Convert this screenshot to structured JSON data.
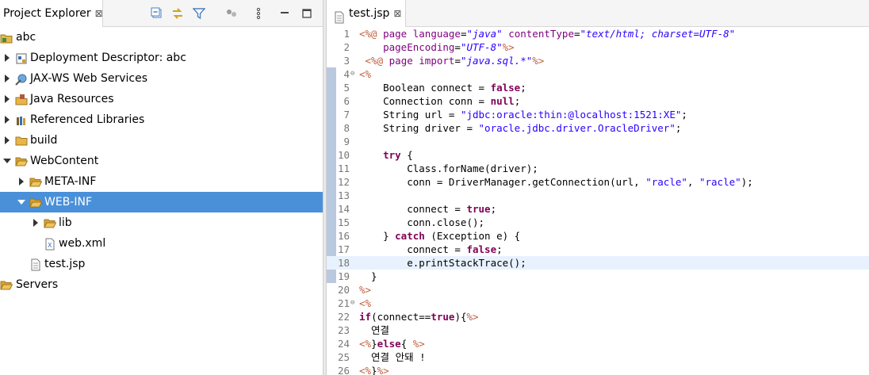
{
  "explorer": {
    "title": "Project Explorer",
    "close_glyph": "⊠",
    "toolbar_icons": [
      "collapse-all-icon",
      "link-with-editor-icon",
      "filter-icon",
      "overview-icon",
      "view-menu-icon",
      "minimize-icon",
      "maximize-icon"
    ],
    "tree": [
      {
        "label": "abc",
        "icon": "project-icon",
        "expanded": true
      },
      {
        "label": "Deployment Descriptor: abc",
        "icon": "deployment-descriptor-icon",
        "expanded": false
      },
      {
        "label": "JAX-WS Web Services",
        "icon": "web-services-icon",
        "expanded": false
      },
      {
        "label": "Java Resources",
        "icon": "java-resources-icon",
        "expanded": false
      },
      {
        "label": "Referenced Libraries",
        "icon": "libraries-icon",
        "expanded": false
      },
      {
        "label": "build",
        "icon": "folder-icon",
        "expanded": false
      },
      {
        "label": "WebContent",
        "icon": "folder-open-icon",
        "expanded": true
      },
      {
        "label": "META-INF",
        "icon": "folder-icon",
        "expanded": false
      },
      {
        "label": "WEB-INF",
        "icon": "folder-open-icon",
        "expanded": true,
        "selected": true
      },
      {
        "label": "lib",
        "icon": "folder-icon",
        "expanded": false
      },
      {
        "label": "web.xml",
        "icon": "xml-file-icon"
      },
      {
        "label": "test.jsp",
        "icon": "jsp-file-icon"
      },
      {
        "label": "Servers",
        "icon": "folder-open-icon"
      }
    ]
  },
  "editor": {
    "tab_label": "test.jsp",
    "close_glyph": "⊠",
    "current_line": 18,
    "lines": [
      {
        "n": "1",
        "fold": "",
        "tokens": [
          [
            "tag",
            "<%@ "
          ],
          [
            "attr",
            "page "
          ],
          [
            "attr",
            "language"
          ],
          [
            "plain",
            "="
          ],
          [
            "val",
            "\"java\""
          ],
          [
            "plain",
            " "
          ],
          [
            "attr",
            "contentType"
          ],
          [
            "plain",
            "="
          ],
          [
            "val",
            "\"text/html; charset=UTF-8\""
          ]
        ]
      },
      {
        "n": "2",
        "fold": "",
        "tokens": [
          [
            "plain",
            "    "
          ],
          [
            "attr",
            "pageEncoding"
          ],
          [
            "plain",
            "="
          ],
          [
            "val",
            "\"UTF-8\""
          ],
          [
            "tag",
            "%>"
          ]
        ]
      },
      {
        "n": "3",
        "fold": "",
        "tokens": [
          [
            "plain",
            " "
          ],
          [
            "tag",
            "<%@ "
          ],
          [
            "attr",
            "page "
          ],
          [
            "attr",
            "import"
          ],
          [
            "plain",
            "="
          ],
          [
            "val",
            "\"java.sql.*\""
          ],
          [
            "tag",
            "%>"
          ]
        ]
      },
      {
        "n": "4",
        "fold": "⊖",
        "tokens": [
          [
            "tag",
            "<%"
          ]
        ]
      },
      {
        "n": "5",
        "fold": "",
        "tokens": [
          [
            "plain",
            "    Boolean connect = "
          ],
          [
            "kw",
            "false"
          ],
          [
            "plain",
            ";"
          ]
        ]
      },
      {
        "n": "6",
        "fold": "",
        "tokens": [
          [
            "plain",
            "    Connection conn = "
          ],
          [
            "kw",
            "null"
          ],
          [
            "plain",
            ";"
          ]
        ]
      },
      {
        "n": "7",
        "fold": "",
        "tokens": [
          [
            "plain",
            "    String url = "
          ],
          [
            "str",
            "\"jdbc:oracle:thin:@localhost:1521:XE\""
          ],
          [
            "plain",
            ";"
          ]
        ]
      },
      {
        "n": "8",
        "fold": "",
        "tokens": [
          [
            "plain",
            "    String driver = "
          ],
          [
            "str",
            "\"oracle.jdbc.driver.OracleDriver\""
          ],
          [
            "plain",
            ";"
          ]
        ]
      },
      {
        "n": "9",
        "fold": "",
        "tokens": []
      },
      {
        "n": "10",
        "fold": "",
        "tokens": [
          [
            "plain",
            "    "
          ],
          [
            "kw",
            "try"
          ],
          [
            "plain",
            " {"
          ]
        ]
      },
      {
        "n": "11",
        "fold": "",
        "tokens": [
          [
            "plain",
            "        Class.forName(driver);"
          ]
        ]
      },
      {
        "n": "12",
        "fold": "",
        "tokens": [
          [
            "plain",
            "        conn = DriverManager.getConnection(url, "
          ],
          [
            "str",
            "\"racle\""
          ],
          [
            "plain",
            ", "
          ],
          [
            "str",
            "\"racle\""
          ],
          [
            "plain",
            ");"
          ]
        ]
      },
      {
        "n": "13",
        "fold": "",
        "tokens": []
      },
      {
        "n": "14",
        "fold": "",
        "tokens": [
          [
            "plain",
            "        connect = "
          ],
          [
            "kw",
            "true"
          ],
          [
            "plain",
            ";"
          ]
        ]
      },
      {
        "n": "15",
        "fold": "",
        "tokens": [
          [
            "plain",
            "        conn.close();"
          ]
        ]
      },
      {
        "n": "16",
        "fold": "",
        "tokens": [
          [
            "plain",
            "    } "
          ],
          [
            "kw",
            "catch"
          ],
          [
            "plain",
            " (Exception e) {"
          ]
        ]
      },
      {
        "n": "17",
        "fold": "",
        "tokens": [
          [
            "plain",
            "        connect = "
          ],
          [
            "kw",
            "false"
          ],
          [
            "plain",
            ";"
          ]
        ]
      },
      {
        "n": "18",
        "fold": "",
        "tokens": [
          [
            "plain",
            "        e.printStackTrace();"
          ]
        ]
      },
      {
        "n": "19",
        "fold": "",
        "tokens": [
          [
            "plain",
            "  }"
          ]
        ]
      },
      {
        "n": "20",
        "fold": "",
        "tokens": [
          [
            "tag",
            "%>"
          ]
        ]
      },
      {
        "n": "21",
        "fold": "⊖",
        "tokens": [
          [
            "tag",
            "<%"
          ]
        ]
      },
      {
        "n": "22",
        "fold": "",
        "tokens": [
          [
            "kw",
            "if"
          ],
          [
            "plain",
            "(connect=="
          ],
          [
            "kw",
            "true"
          ],
          [
            "plain",
            "){"
          ],
          [
            "tag",
            "%>"
          ]
        ]
      },
      {
        "n": "23",
        "fold": "",
        "tokens": [
          [
            "plain",
            "  연결"
          ]
        ]
      },
      {
        "n": "24",
        "fold": "",
        "tokens": [
          [
            "tag",
            "<%"
          ],
          [
            "plain",
            "}"
          ],
          [
            "kw",
            "else"
          ],
          [
            "plain",
            "{ "
          ],
          [
            "tag",
            "%>"
          ]
        ]
      },
      {
        "n": "25",
        "fold": "",
        "tokens": [
          [
            "plain",
            "  연결 안돼 !"
          ]
        ]
      },
      {
        "n": "26",
        "fold": "",
        "tokens": [
          [
            "tag",
            "<%"
          ],
          [
            "plain",
            "}"
          ],
          [
            "tag",
            "%>"
          ]
        ]
      }
    ]
  },
  "colors": {
    "selection": "#4a90d9",
    "jsp_tag": "#bf5f3f",
    "keyword": "#7f0055",
    "string": "#2a00ff",
    "attribute": "#7f007f",
    "folder": "#e8b548"
  }
}
